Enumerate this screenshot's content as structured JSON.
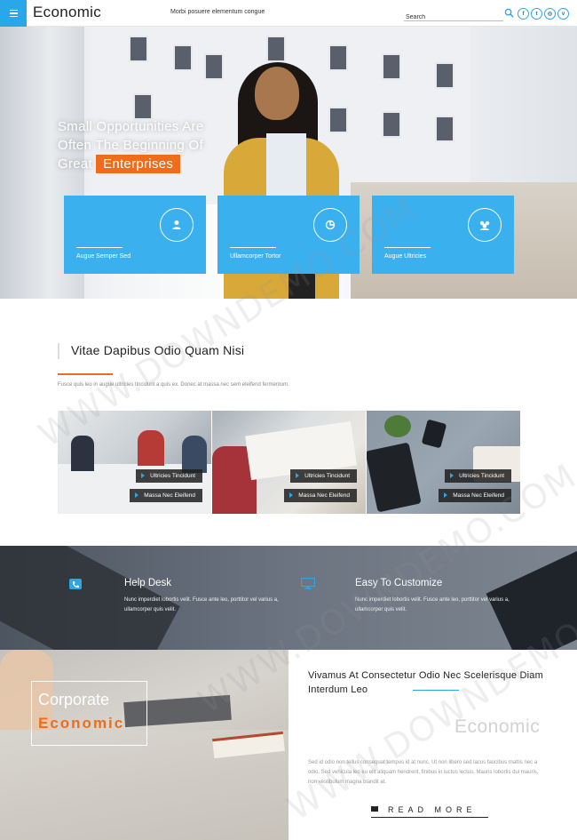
{
  "header": {
    "brand": "Economic",
    "tagline": "Morbi posuere elementum congue",
    "search_placeholder": "Search",
    "socials": [
      {
        "icon": "facebook-icon",
        "glyph": "f"
      },
      {
        "icon": "twitter-icon",
        "glyph": "t"
      },
      {
        "icon": "instagram-icon",
        "glyph": "◎"
      },
      {
        "icon": "vimeo-icon",
        "glyph": "v"
      }
    ]
  },
  "hero": {
    "title_line1": "Small Opportunities Are",
    "title_line2": "Often The Beginning Of",
    "title_line3": "Great",
    "title_accent": "Enterprises",
    "features": [
      {
        "label": "Augue Semper Sed",
        "icon": "user-icon"
      },
      {
        "label": "Ullamcorper Tortor",
        "icon": "chart-icon"
      },
      {
        "label": "Augue Ultricies",
        "icon": "group-icon"
      }
    ]
  },
  "about": {
    "title": "Vitae Dapibus Odio Quam Nisi",
    "description": "Fusce quis leo in augue ultricies tincidunt a quis ex. Donec at massa nec sem eleifend fermentum.",
    "gallery": [
      {
        "tag1": "Ultricies Tincidunt",
        "tag2": "Massa Nec Eleifend"
      },
      {
        "tag1": "Ultricies Tincidunt",
        "tag2": "Massa Nec Eleifend"
      },
      {
        "tag1": "Ultricies Tincidunt",
        "tag2": "Massa Nec Eleifend"
      }
    ]
  },
  "services": [
    {
      "title": "Help Desk",
      "icon": "phone-icon",
      "text": "Nunc imperdiet lobortis velit. Fusce ante leo, porttitor vel varius a, ullamcorper quis velit."
    },
    {
      "title": "Easy To Customize",
      "icon": "monitor-icon",
      "text": "Nunc imperdiet lobortis velit. Fusce ante leo, porttitor vel varius a, ullamcorper quis velit."
    }
  ],
  "corporate": {
    "line1": "Corporate",
    "line2": "Economic"
  },
  "promo": {
    "title": "Vivamus At Consectetur Odio Nec Scelerisque Diam Interdum Leo",
    "watermark": "Economic",
    "text": "Sed id odio non tellus consequat tempus id at nunc. Ut non libero sed lacus faucibus mattis nec a odio. Sed vehicula leo eu elit aliquam hendrerit, finibus in luctus lectus. Mauris lobortis dui mauris, non vestibulum magna blandit at.",
    "button": "READ MORE"
  },
  "watermark_text": "WWW.DOWNDEMO.COM",
  "colors": {
    "accent_blue": "#2aa7e8",
    "feature_blue": "#3bb0ee",
    "accent_orange": "#ef6c1a",
    "dark_band": "#5f6873"
  }
}
